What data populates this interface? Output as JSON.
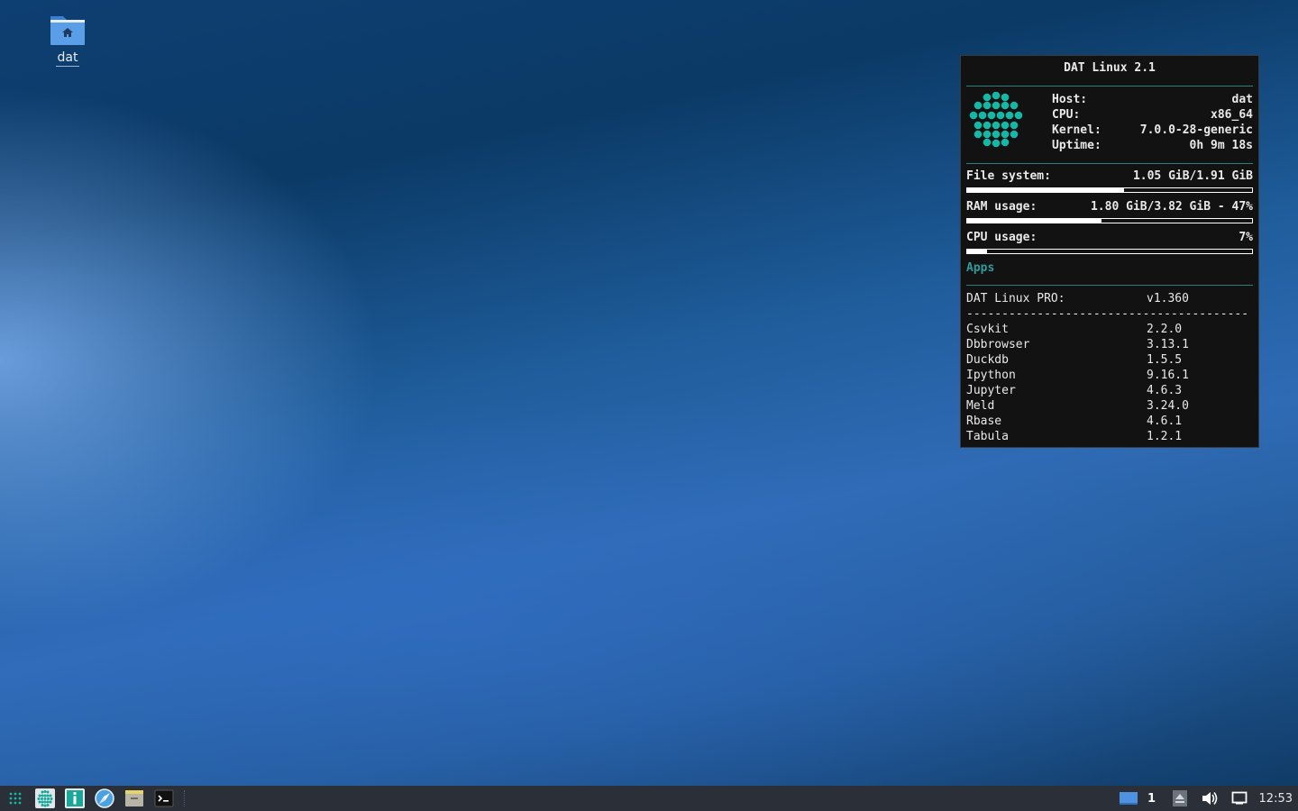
{
  "desktop": {
    "icons": [
      {
        "label": "dat",
        "icon": "home-folder-icon"
      }
    ]
  },
  "conky": {
    "title": "DAT Linux 2.1",
    "sysinfo": [
      {
        "key": "Host:",
        "value": "dat"
      },
      {
        "key": "CPU:",
        "value": "x86_64"
      },
      {
        "key": "Kernel:",
        "value": "7.0.0-28-generic"
      },
      {
        "key": "Uptime:",
        "value": "0h 9m 18s"
      }
    ],
    "filesystem": {
      "label": "File system:",
      "value": "1.05 GiB/1.91 GiB",
      "fraction": 0.55
    },
    "ram": {
      "label": "RAM usage:",
      "value": "1.80 GiB/3.82 GiB - 47%",
      "fraction": 0.47
    },
    "cpu": {
      "label": "CPU usage:",
      "value": "7%",
      "fraction": 0.07
    },
    "apps_header": "Apps",
    "pro": {
      "name": "DAT Linux PRO:",
      "version": "v1.360"
    },
    "separator": "----------------------------------------",
    "apps": [
      {
        "name": "Csvkit",
        "version": "2.2.0"
      },
      {
        "name": "Dbbrowser",
        "version": "3.13.1"
      },
      {
        "name": "Duckdb",
        "version": "1.5.5"
      },
      {
        "name": "Ipython",
        "version": "9.16.1"
      },
      {
        "name": "Jupyter",
        "version": "4.6.3"
      },
      {
        "name": "Meld",
        "version": "3.24.0"
      },
      {
        "name": "Rbase",
        "version": "4.6.1"
      },
      {
        "name": "Tabula",
        "version": "1.2.1"
      }
    ],
    "accent": "#14b8a6"
  },
  "taskbar": {
    "launchers": [
      "app-grid-icon",
      "dat-linux-icon",
      "info-icon",
      "browser-icon",
      "file-manager-icon",
      "terminal-icon"
    ],
    "workspace": "1",
    "clock": "12:53",
    "background": "#2a2f38"
  }
}
